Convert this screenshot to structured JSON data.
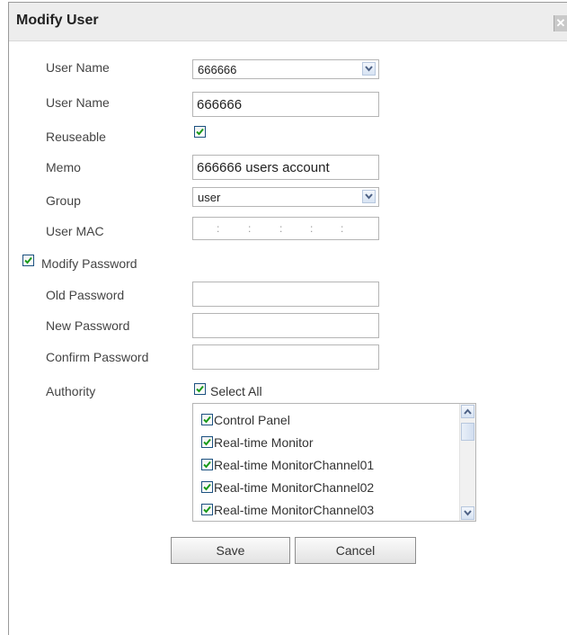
{
  "dialog": {
    "title": "Modify User",
    "close_icon": "close-icon"
  },
  "form": {
    "user_name_select": {
      "label": "User Name",
      "value": "666666"
    },
    "user_name": {
      "label": "User Name",
      "value": "666666"
    },
    "reuseable": {
      "label": "Reuseable",
      "checked": true
    },
    "memo": {
      "label": "Memo",
      "value": "666666 users account"
    },
    "group": {
      "label": "Group",
      "value": "user"
    },
    "user_mac": {
      "label": "User MAC",
      "separators": [
        ":",
        ":",
        ":",
        ":",
        ":"
      ]
    },
    "modify_password": {
      "label": "Modify Password",
      "checked": true
    },
    "old_password": {
      "label": "Old Password",
      "value": ""
    },
    "new_password": {
      "label": "New Password",
      "value": ""
    },
    "confirm_password": {
      "label": "Confirm Password",
      "value": ""
    },
    "authority": {
      "label": "Authority",
      "select_all_label": "Select All",
      "select_all_checked": true
    }
  },
  "authority_list": [
    {
      "label": "Control Panel",
      "checked": true
    },
    {
      "label": "Real-time Monitor",
      "checked": true
    },
    {
      "label": "Real-time MonitorChannel01",
      "checked": true
    },
    {
      "label": "Real-time MonitorChannel02",
      "checked": true
    },
    {
      "label": "Real-time MonitorChannel03",
      "checked": true
    }
  ],
  "buttons": {
    "save": "Save",
    "cancel": "Cancel"
  },
  "colors": {
    "check": "#1a9a1a",
    "checkbox_border": "#1c5180",
    "titlebar": "#ededed"
  }
}
